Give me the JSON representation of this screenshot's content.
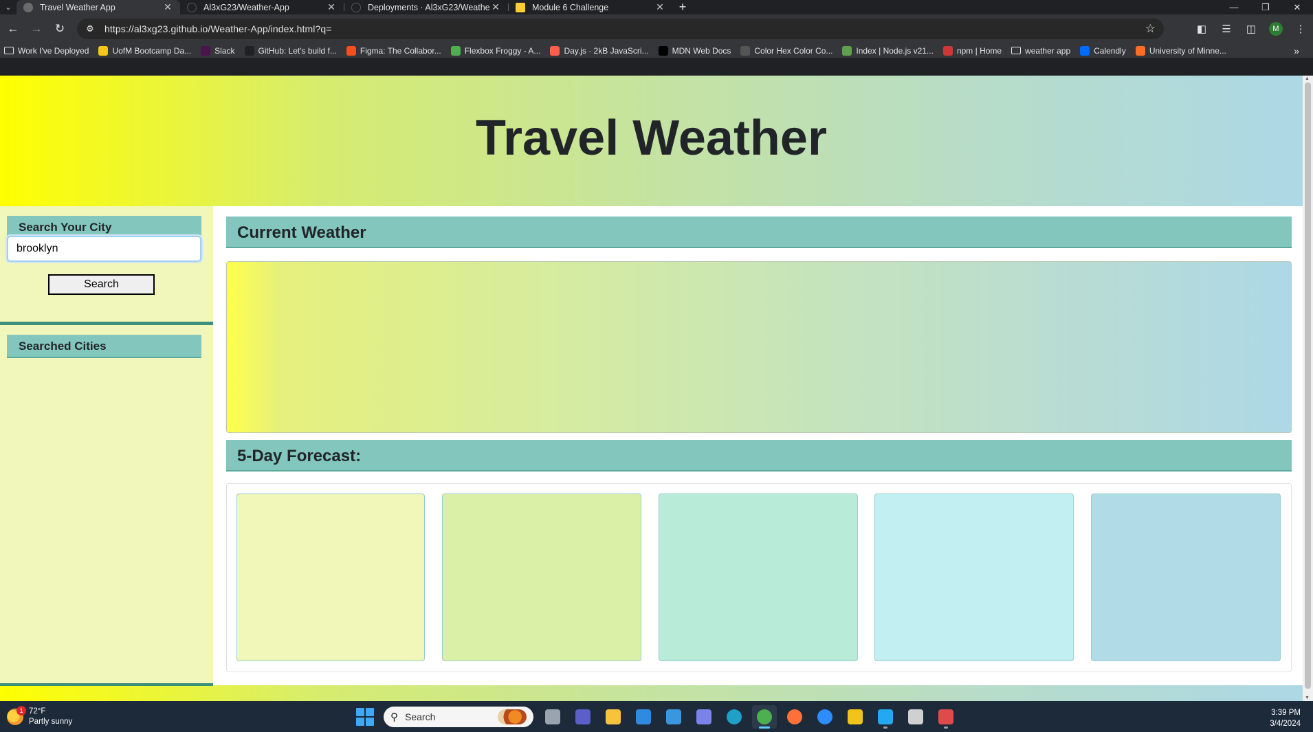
{
  "browser": {
    "tabs": [
      {
        "title": "Travel Weather App",
        "active": true,
        "favicon_color": "#6b6b6b"
      },
      {
        "title": "Al3xG23/Weather-App",
        "active": false,
        "favicon_color": "#202124"
      },
      {
        "title": "Deployments · Al3xG23/Weathe",
        "active": false,
        "favicon_color": "#202124"
      },
      {
        "title": "Module 6 Challenge",
        "active": false,
        "favicon_color": "#ffcc33"
      }
    ],
    "url": "https://al3xg23.github.io/Weather-App/index.html?q=",
    "profile_initial": "M",
    "bookmarks": [
      {
        "label": "Work I've Deployed",
        "icon": "folder-icon",
        "color": "#e3e3e3"
      },
      {
        "label": "UofM Bootcamp Da...",
        "icon": "umn-icon",
        "color": "#f5c518"
      },
      {
        "label": "Slack",
        "icon": "slack-icon",
        "color": "#4a154b"
      },
      {
        "label": "GitHub: Let's build f...",
        "icon": "github-icon",
        "color": "#202124"
      },
      {
        "label": "Figma: The Collabor...",
        "icon": "figma-icon",
        "color": "#f24e1e"
      },
      {
        "label": "Flexbox Froggy - A...",
        "icon": "frog-icon",
        "color": "#4caf50"
      },
      {
        "label": "Day.js · 2kB JavaScri...",
        "icon": "dayjs-icon",
        "color": "#ff5f4c"
      },
      {
        "label": "MDN Web Docs",
        "icon": "mdn-icon",
        "color": "#000000"
      },
      {
        "label": "Color Hex Color Co...",
        "icon": "colorhex-icon",
        "color": "#555555"
      },
      {
        "label": "Index | Node.js v21...",
        "icon": "nodejs-icon",
        "color": "#5fa04e"
      },
      {
        "label": "npm | Home",
        "icon": "npm-icon",
        "color": "#cb3837"
      },
      {
        "label": "weather app",
        "icon": "folder-icon",
        "color": "#e3e3e3"
      },
      {
        "label": "Calendly",
        "icon": "calendly-icon",
        "color": "#006bff"
      },
      {
        "label": "University of Minne...",
        "icon": "gitlab-icon",
        "color": "#fc6d26"
      }
    ]
  },
  "page": {
    "title": "Travel Weather",
    "search": {
      "heading": "Search Your City",
      "input_value": "brooklyn",
      "button_label": "Search"
    },
    "history": {
      "heading": "Searched Cities"
    },
    "current": {
      "heading": "Current Weather"
    },
    "forecast": {
      "heading": "5-Day Forecast:",
      "cards": [
        {
          "color": "#f0f7b8"
        },
        {
          "color": "#daf0a6"
        },
        {
          "color": "#b8ecd9"
        },
        {
          "color": "#c2f0f2"
        },
        {
          "color": "#b2dbe8"
        }
      ]
    }
  },
  "taskbar": {
    "weather_temp": "72°F",
    "weather_desc": "Partly sunny",
    "weather_badge": "1",
    "search_placeholder": "Search",
    "time": "3:39 PM",
    "date": "3/4/2024",
    "apps": [
      {
        "name": "task-view-icon",
        "color": "#9aa4ae",
        "running": false
      },
      {
        "name": "meet-icon",
        "color": "#5b5fc7",
        "running": false
      },
      {
        "name": "file-explorer-icon",
        "color": "#f9c23c",
        "running": false
      },
      {
        "name": "store-icon",
        "color": "#2f8ae0",
        "running": false
      },
      {
        "name": "mail-icon",
        "color": "#3a96dd",
        "running": false
      },
      {
        "name": "copilot-icon",
        "color": "#7b83eb",
        "running": false
      },
      {
        "name": "edge-icon",
        "color": "#1fa0c8",
        "running": false
      },
      {
        "name": "chrome-icon",
        "color": "#4caf50",
        "running": true,
        "active": true
      },
      {
        "name": "firefox-icon",
        "color": "#ff7139",
        "running": false
      },
      {
        "name": "zoom-icon",
        "color": "#2d8cff",
        "running": false
      },
      {
        "name": "git-icon",
        "color": "#f0c419",
        "running": false
      },
      {
        "name": "vscode-icon",
        "color": "#23a9f2",
        "running": true
      },
      {
        "name": "terminal-icon",
        "color": "#d0d0d0",
        "running": false
      },
      {
        "name": "snipping-tool-icon",
        "color": "#e04a4a",
        "running": true
      }
    ]
  }
}
